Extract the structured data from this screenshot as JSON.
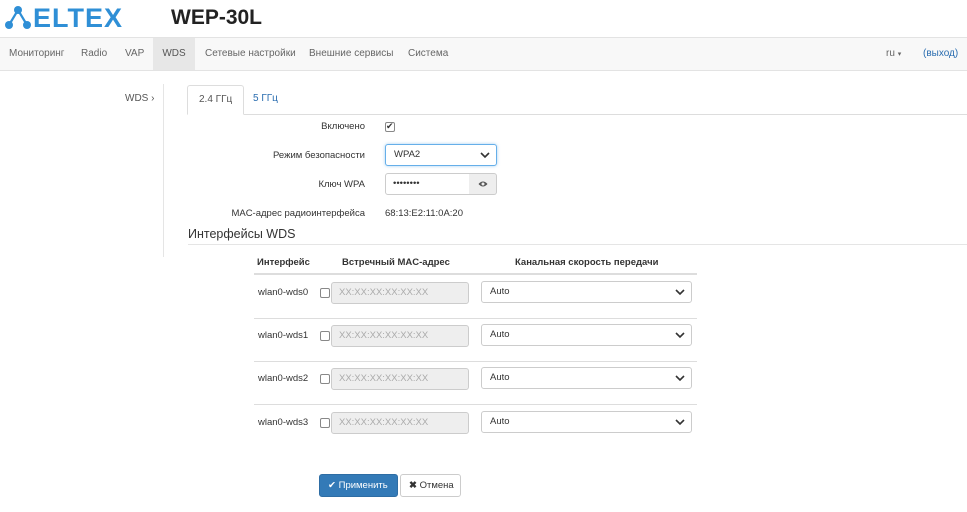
{
  "brand": {
    "logo_text": "ELTEX",
    "accent": "#2f8fd6"
  },
  "device": {
    "title": "WEP-30L"
  },
  "nav": {
    "items": [
      "Мониторинг",
      "Radio",
      "VAP",
      "WDS",
      "Сетевые настройки",
      "Внешние сервисы",
      "Система"
    ],
    "active": "WDS",
    "lang": "ru",
    "logout": "(выход)"
  },
  "sidebar": {
    "item": "WDS ›"
  },
  "tabs": {
    "active": "2.4 ГГц",
    "inactive": "5 ГГц"
  },
  "form": {
    "enabled_label": "Включено",
    "enabled": true,
    "security_label": "Режим безопасности",
    "security_value": "WPA2",
    "key_label": "Ключ WPA",
    "key_value": "••••••••",
    "mac_label": "MAC-адрес радиоинтерфейса",
    "mac_value": "68:13:E2:11:0A:20"
  },
  "wds": {
    "title": "Интерфейсы WDS",
    "headers": {
      "iface": "Интерфейс",
      "peer_mac": "Встречный MAC-адрес",
      "rate": "Канальная скорость передачи"
    },
    "placeholder": "XX:XX:XX:XX:XX:XX",
    "rows": [
      {
        "name": "wlan0-wds0",
        "checked": false,
        "rate": "Auto"
      },
      {
        "name": "wlan0-wds1",
        "checked": false,
        "rate": "Auto"
      },
      {
        "name": "wlan0-wds2",
        "checked": false,
        "rate": "Auto"
      },
      {
        "name": "wlan0-wds3",
        "checked": false,
        "rate": "Auto"
      }
    ]
  },
  "buttons": {
    "apply": "Применить",
    "cancel": "Отмена",
    "apply_color": "#337ab7"
  }
}
